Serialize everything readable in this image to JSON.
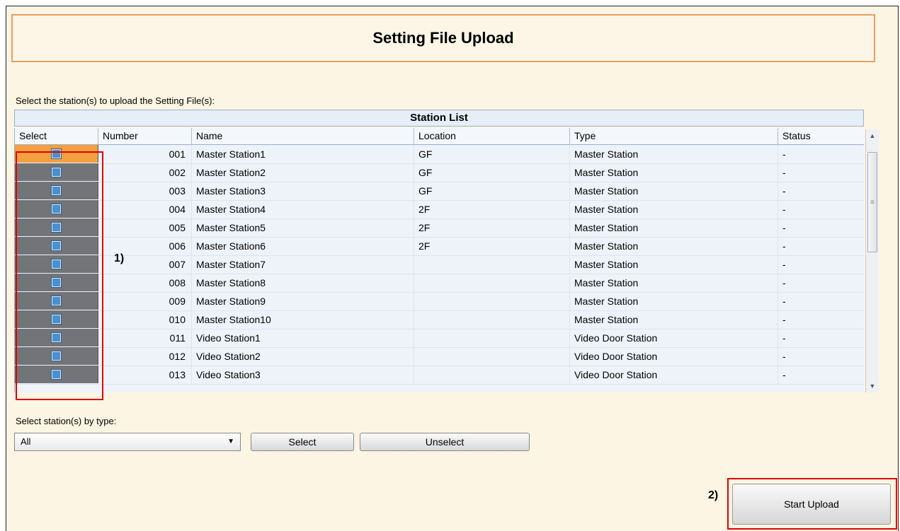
{
  "title": "Setting File Upload",
  "instruction": "Select the station(s) to upload the Setting File(s):",
  "station_list": {
    "header": "Station List",
    "columns": [
      "Select",
      "Number",
      "Name",
      "Location",
      "Type",
      "Status"
    ],
    "rows": [
      {
        "number": "001",
        "name": "Master Station1",
        "location": "GF",
        "type": "Master Station",
        "status": "-"
      },
      {
        "number": "002",
        "name": "Master Station2",
        "location": "GF",
        "type": "Master Station",
        "status": "-"
      },
      {
        "number": "003",
        "name": "Master Station3",
        "location": "GF",
        "type": "Master Station",
        "status": "-"
      },
      {
        "number": "004",
        "name": "Master Station4",
        "location": "2F",
        "type": "Master Station",
        "status": "-"
      },
      {
        "number": "005",
        "name": "Master Station5",
        "location": "2F",
        "type": "Master Station",
        "status": "-"
      },
      {
        "number": "006",
        "name": "Master Station6",
        "location": "2F",
        "type": "Master Station",
        "status": "-"
      },
      {
        "number": "007",
        "name": "Master Station7",
        "location": "",
        "type": "Master Station",
        "status": "-"
      },
      {
        "number": "008",
        "name": "Master Station8",
        "location": "",
        "type": "Master Station",
        "status": "-"
      },
      {
        "number": "009",
        "name": "Master Station9",
        "location": "",
        "type": "Master Station",
        "status": "-"
      },
      {
        "number": "010",
        "name": "Master Station10",
        "location": "",
        "type": "Master Station",
        "status": "-"
      },
      {
        "number": "011",
        "name": "Video Station1",
        "location": "",
        "type": "Video Door Station",
        "status": "-"
      },
      {
        "number": "012",
        "name": "Video Station2",
        "location": "",
        "type": "Video Door Station",
        "status": "-"
      },
      {
        "number": "013",
        "name": "Video Station3",
        "location": "",
        "type": "Video Door Station",
        "status": "-"
      }
    ]
  },
  "type_selector": {
    "label": "Select station(s) by type:",
    "selected": "All",
    "select_button": "Select",
    "unselect_button": "Unselect"
  },
  "start_upload_button": "Start Upload",
  "annotations": {
    "marker_1": "1)",
    "marker_2": "2)"
  },
  "colors": {
    "selected_row": "#f4a040",
    "unselected_row": "#737478",
    "highlight_box": "#e00000",
    "title_border": "#e8a060"
  }
}
